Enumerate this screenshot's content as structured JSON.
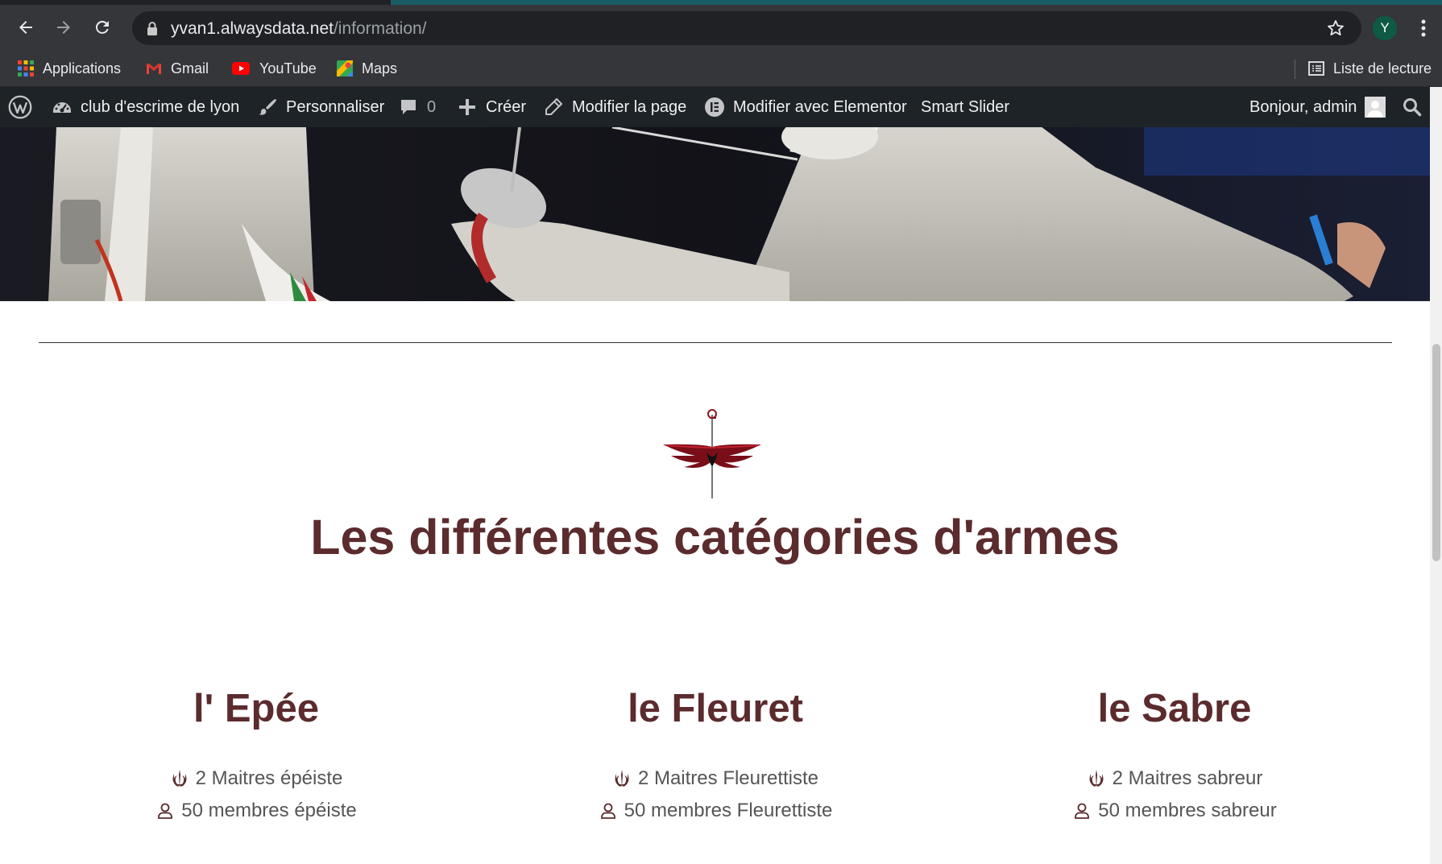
{
  "browser": {
    "url_domain": "yvan1.alwaysdata.net",
    "url_path": "/information/",
    "profile_initial": "Y",
    "bookmarks": [
      {
        "label": "Applications",
        "icon": "apps-grid-icon"
      },
      {
        "label": "Gmail",
        "icon": "gmail-icon"
      },
      {
        "label": "YouTube",
        "icon": "youtube-icon"
      },
      {
        "label": "Maps",
        "icon": "maps-icon"
      }
    ],
    "reading_list": "Liste de lecture"
  },
  "adminbar": {
    "site_name": "club d'escrime de lyon",
    "customize": "Personnaliser",
    "comments_count": "0",
    "new": "Créer",
    "edit_page": "Modifier la page",
    "elementor": "Modifier avec Elementor",
    "smart_slider": "Smart Slider",
    "greeting": "Bonjour, admin"
  },
  "page": {
    "title": "Les différentes catégories d'armes",
    "weapons": [
      {
        "name": "l' Epée",
        "masters": "2 Maitres épéiste",
        "members": "50 membres épéiste"
      },
      {
        "name": "le Fleuret",
        "masters": "2 Maitres Fleurettiste",
        "members": "50 membres Fleurettiste"
      },
      {
        "name": "le Sabre",
        "masters": "2 Maitres sabreur",
        "members": "50 membres sabreur"
      }
    ]
  },
  "colors": {
    "heading": "#5b2b2e",
    "chrome": "#35363a",
    "adminbar": "#1d2327",
    "emblem_red": "#8b1520"
  }
}
